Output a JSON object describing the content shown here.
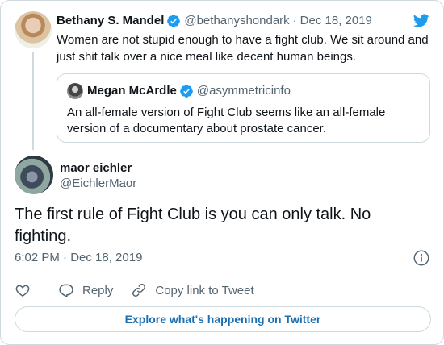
{
  "parent": {
    "name": "Bethany S. Mandel",
    "handle": "@bethanyshondark",
    "separator": "·",
    "date": "Dec 18, 2019",
    "text": "Women are not stupid enough to have a fight club. We sit around and just shit talk over a nice meal like decent human beings.",
    "verified": true
  },
  "quote": {
    "name": "Megan McArdle",
    "handle": "@asymmetricinfo",
    "text": "An all-female version of Fight Club seems like an all-female version of a documentary about prostate cancer.",
    "verified": true
  },
  "main": {
    "name": "maor eichler",
    "handle": "@EichlerMaor",
    "text": "The first rule of Fight Club is you can only talk. No fighting.",
    "timestamp": "6:02 PM · Dec 18, 2019"
  },
  "actions": {
    "reply_label": "Reply",
    "copy_label": "Copy link to Tweet"
  },
  "explore_label": "Explore what's happening on Twitter",
  "colors": {
    "brand": "#1d9bf0",
    "link": "#1d6fb0",
    "border": "#cfd9de",
    "secondary_text": "#536471"
  },
  "icons": [
    "twitter-bird-icon",
    "verified-badge-icon",
    "info-icon",
    "heart-icon",
    "reply-bubble-icon",
    "link-icon"
  ]
}
